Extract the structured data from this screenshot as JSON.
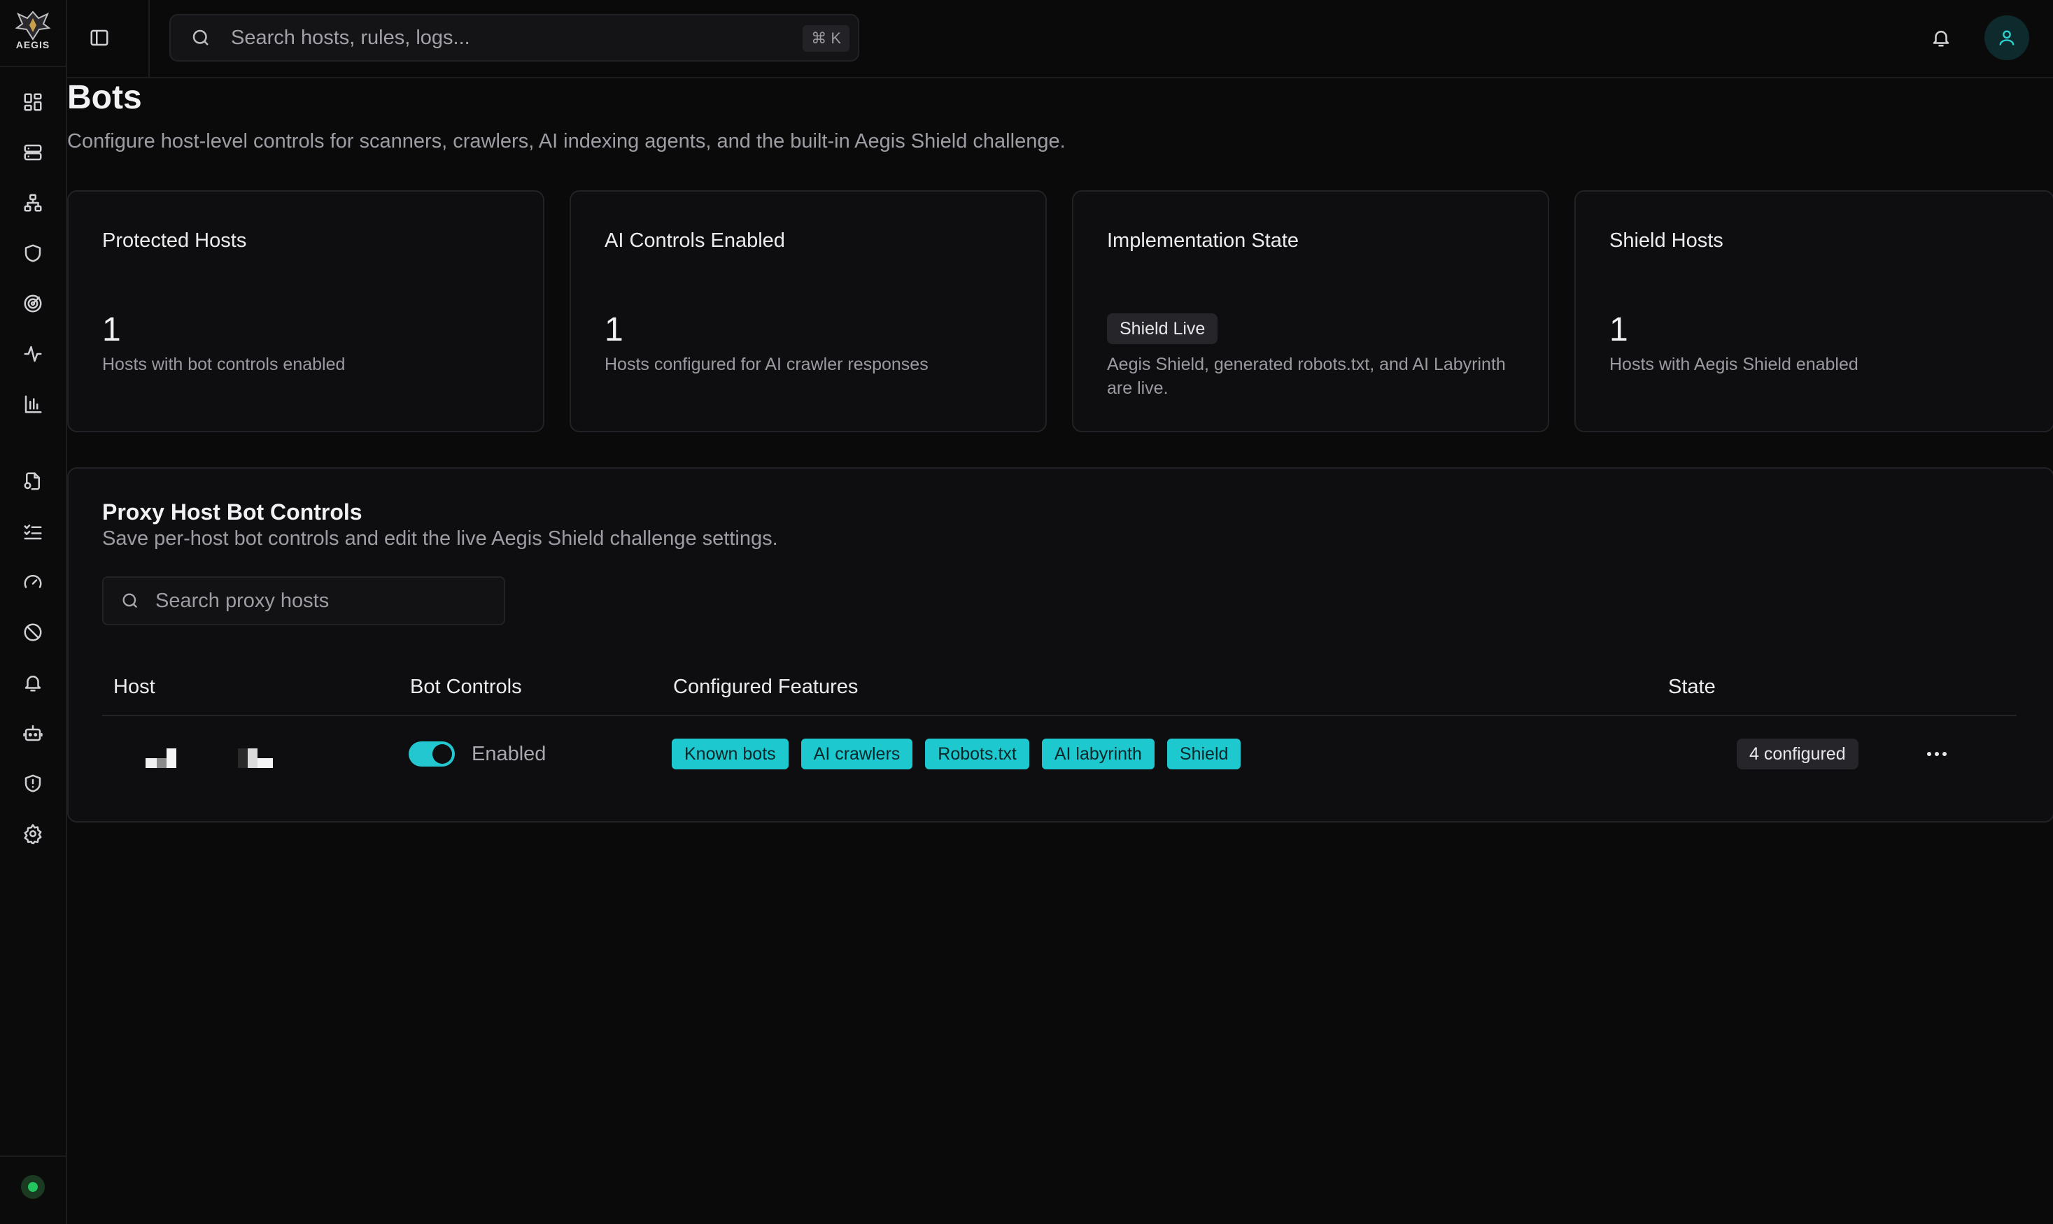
{
  "brand": {
    "wordmark": "AEGIS"
  },
  "topbar": {
    "search_placeholder": "Search hosts, rules, logs...",
    "shortcut": "⌘ K"
  },
  "sidebar": {
    "icons": [
      "dashboard-icon",
      "server-icon",
      "network-icon",
      "shield-icon",
      "target-icon",
      "activity-icon",
      "bar-chart-icon",
      "file-certificate-icon",
      "checklist-icon",
      "gauge-icon",
      "ban-icon",
      "bell-icon",
      "bot-icon",
      "shield-alert-icon",
      "settings-icon"
    ]
  },
  "page": {
    "title": "Bots",
    "subtitle": "Configure host-level controls for scanners, crawlers, AI indexing agents, and the built-in Aegis Shield challenge."
  },
  "cards": [
    {
      "title": "Protected Hosts",
      "value": "1",
      "description": "Hosts with bot controls enabled"
    },
    {
      "title": "AI Controls Enabled",
      "value": "1",
      "description": "Hosts configured for AI crawler responses"
    },
    {
      "title": "Implementation State",
      "badge": "Shield Live",
      "description": "Aegis Shield, generated robots.txt, and AI Labyrinth are live."
    },
    {
      "title": "Shield Hosts",
      "value": "1",
      "description": "Hosts with Aegis Shield enabled"
    }
  ],
  "panel": {
    "title": "Proxy Host Bot Controls",
    "subtitle": "Save per-host bot controls and edit the live Aegis Shield challenge settings.",
    "search_placeholder": "Search proxy hosts",
    "columns": {
      "host": "Host",
      "bot_controls": "Bot Controls",
      "features": "Configured Features",
      "state": "State"
    },
    "rows": [
      {
        "bot_controls_enabled": true,
        "bot_controls_label": "Enabled",
        "features": [
          "Known bots",
          "AI crawlers",
          "Robots.txt",
          "AI labyrinth",
          "Shield"
        ],
        "state": "4 configured"
      }
    ]
  },
  "colors": {
    "accent": "#1ec8cf",
    "status_online": "#22c55e",
    "background": "#0a0a0b"
  }
}
